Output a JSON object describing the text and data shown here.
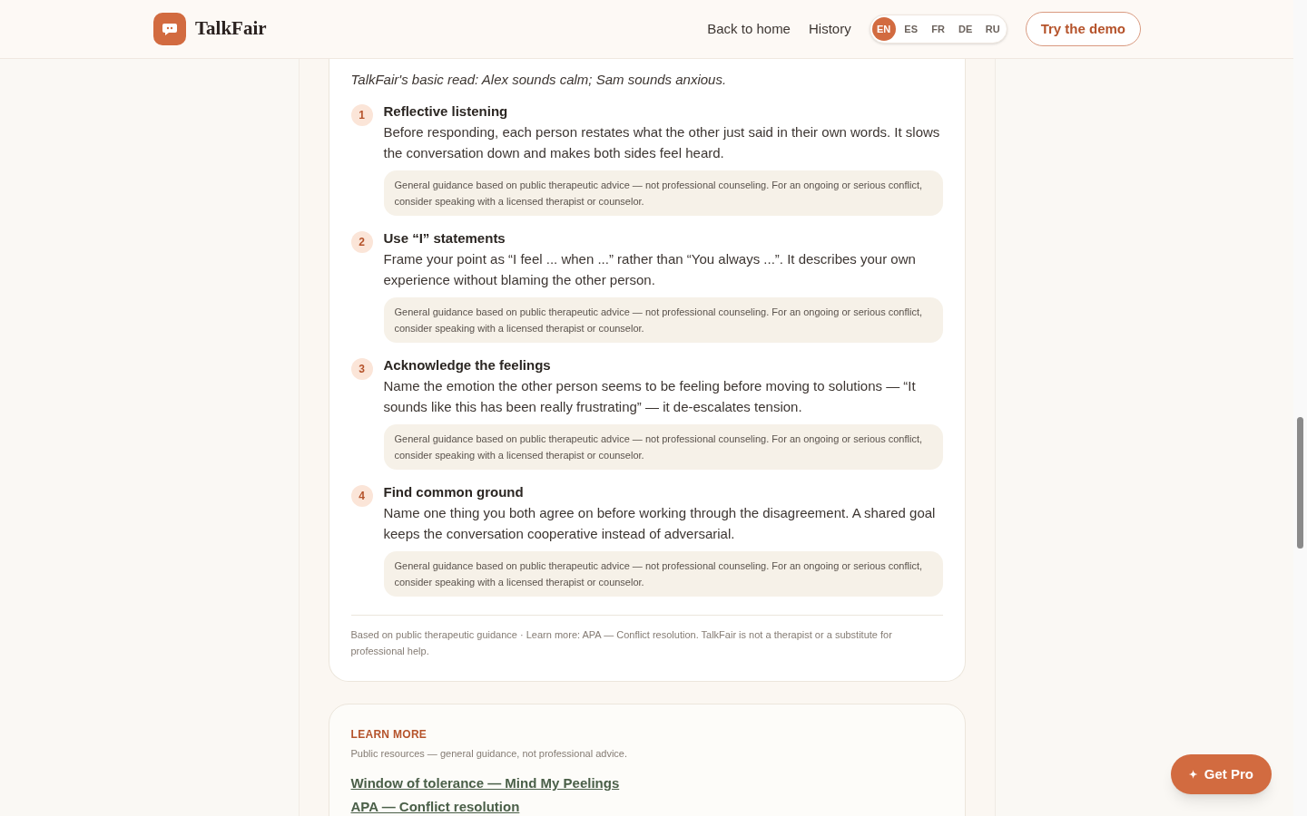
{
  "header": {
    "brand": "TalkFair",
    "nav": [
      "Back to home",
      "History"
    ],
    "languages": [
      {
        "code": "EN",
        "selected": true
      },
      {
        "code": "ES",
        "selected": false
      },
      {
        "code": "FR",
        "selected": false
      },
      {
        "code": "DE",
        "selected": false
      },
      {
        "code": "RU",
        "selected": false
      }
    ],
    "cta": "Try the demo"
  },
  "suggestion": {
    "read": "TalkFair's basic read: Alex sounds calm; Sam sounds anxious.",
    "steps": [
      {
        "number": "1",
        "title": "Reflective listening",
        "body": "Before responding, each person restates what the other just said in their own words. It slows the conversation down and makes both sides feel heard.",
        "note": "General guidance based on public therapeutic advice — not professional counseling. For an ongoing or serious conflict, consider speaking with a licensed therapist or counselor."
      },
      {
        "number": "2",
        "title": "Use “I” statements",
        "body": "Frame your point as “I feel ... when ...” rather than “You always ...”. It describes your own experience without blaming the other person.",
        "note": "General guidance based on public therapeutic advice — not professional counseling. For an ongoing or serious conflict, consider speaking with a licensed therapist or counselor."
      },
      {
        "number": "3",
        "title": "Acknowledge the feelings",
        "body": "Name the emotion the other person seems to be feeling before moving to solutions — “It sounds like this has been really frustrating” — it de-escalates tension.",
        "note": "General guidance based on public therapeutic advice — not professional counseling. For an ongoing or serious conflict, consider speaking with a licensed therapist or counselor."
      },
      {
        "number": "4",
        "title": "Find common ground",
        "body": "Name one thing you both agree on before working through the disagreement. A shared goal keeps the conversation cooperative instead of adversarial.",
        "note": "General guidance based on public therapeutic advice — not professional counseling. For an ongoing or serious conflict, consider speaking with a licensed therapist or counselor."
      }
    ],
    "footnote": "Based on public therapeutic guidance · Learn more: APA — Conflict resolution. TalkFair is not a therapist or a substitute for professional help."
  },
  "learn_more": {
    "heading": "LEARN MORE",
    "subtitle": "Public resources — general guidance, not professional advice.",
    "links": [
      "Window of tolerance — Mind My Peelings",
      "APA — Conflict resolution"
    ]
  },
  "get_pro": {
    "icon": "✦",
    "label": "Get Pro"
  }
}
